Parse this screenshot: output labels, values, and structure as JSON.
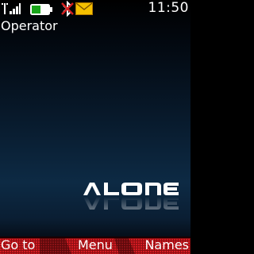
{
  "status": {
    "time": "11:50",
    "operator": "Operator",
    "icons": [
      "signal-icon",
      "battery-icon",
      "bluetooth-icon",
      "message-icon"
    ],
    "battery_color": "#1aa51a",
    "message_color": "#f5c000",
    "bluetooth_color": "#d42020"
  },
  "wallpaper": {
    "logo_text": "ALONE",
    "background_color": "#0d2a44"
  },
  "softkeys": {
    "left": "Go to",
    "middle": "Menu",
    "right": "Names",
    "bar_color": "#c4161c"
  }
}
